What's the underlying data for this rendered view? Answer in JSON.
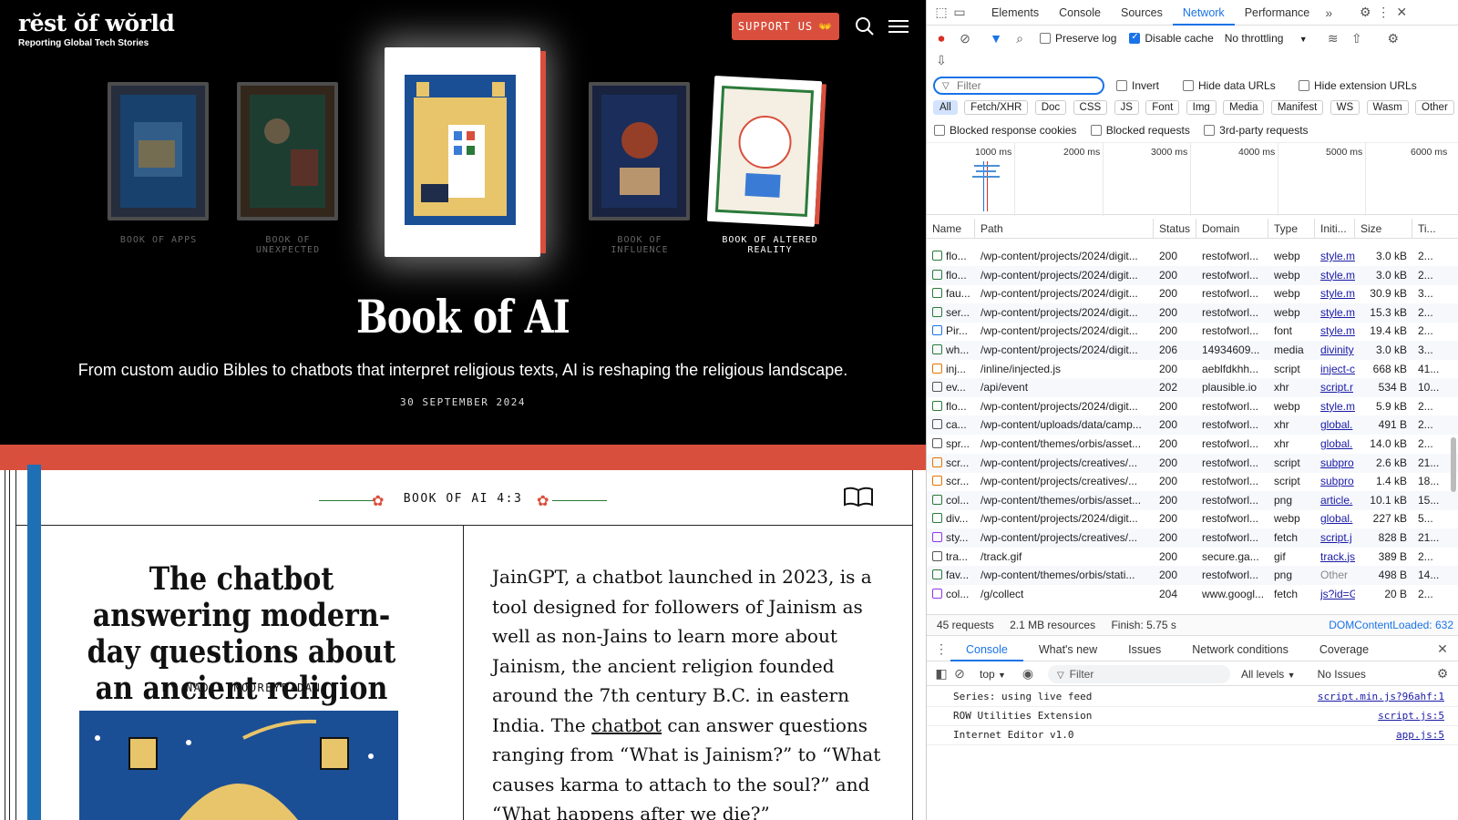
{
  "site": {
    "logo_name": "rĕst ŏf wŏrld",
    "logo_tagline": "Reporting Global Tech Stories",
    "support_label": "SUPPORT US",
    "support_icon": "👐",
    "books": [
      {
        "caption": "BOOK OF APPS"
      },
      {
        "caption": "BOOK OF\nUNEXPECTED"
      },
      {
        "caption": ""
      },
      {
        "caption": "BOOK OF\nINFLUENCE"
      },
      {
        "caption": "BOOK OF ALTERED\nREALITY"
      }
    ],
    "hero_title": "Book of AI",
    "hero_subtitle": "From custom audio Bibles to chatbots that interpret religious texts, AI is reshaping the religious landscape.",
    "hero_date": "30 SEPTEMBER 2024",
    "chapter_label": "BOOK OF AI 4:3",
    "article_title": "The chatbot answering modern-day questions about an ancient religion",
    "byline": "BY NADIA NOOREYEZDAN",
    "body_before_link": "JainGPT, a chatbot launched in 2023, is a tool designed for followers of Jainism as well as non-Jains to learn more about Jainism, the ancient religion founded around the 7th century B.C. in eastern India. The ",
    "body_link": "chatbot",
    "body_after_link": " can answer questions ranging from “What is Jainism?” to “What causes karma to attach to the soul?” and “What happens after we die?”"
  },
  "devtools": {
    "tabs": [
      "Elements",
      "Console",
      "Sources",
      "Network",
      "Performance"
    ],
    "active_tab": "Network",
    "preserve_log": "Preserve log",
    "disable_cache": "Disable cache",
    "throttling": "No throttling",
    "filter_placeholder": "Filter",
    "invert": "Invert",
    "hide_data_urls": "Hide data URLs",
    "hide_ext_urls": "Hide extension URLs",
    "type_chips": [
      "All",
      "Fetch/XHR",
      "Doc",
      "CSS",
      "JS",
      "Font",
      "Img",
      "Media",
      "Manifest",
      "WS",
      "Wasm",
      "Other"
    ],
    "blocked_cookies": "Blocked response cookies",
    "blocked_requests": "Blocked requests",
    "third_party": "3rd-party requests",
    "timeline_labels": [
      "1000 ms",
      "2000 ms",
      "3000 ms",
      "4000 ms",
      "5000 ms",
      "6000 ms"
    ],
    "columns": [
      "Name",
      "Path",
      "Status",
      "Domain",
      "Type",
      "Initi...",
      "Size",
      "Ti..."
    ],
    "rows": [
      {
        "name": "flo...",
        "path": "/wp-content/projects/2024/digit...",
        "status": "200",
        "domain": "restofworl...",
        "type": "webp",
        "init": "style.m",
        "size": "3.0 kB",
        "time": "2..."
      },
      {
        "name": "flo...",
        "path": "/wp-content/projects/2024/digit...",
        "status": "200",
        "domain": "restofworl...",
        "type": "webp",
        "init": "style.m",
        "size": "3.0 kB",
        "time": "2..."
      },
      {
        "name": "fau...",
        "path": "/wp-content/projects/2024/digit...",
        "status": "200",
        "domain": "restofworl...",
        "type": "webp",
        "init": "style.m",
        "size": "30.9 kB",
        "time": "3..."
      },
      {
        "name": "ser...",
        "path": "/wp-content/projects/2024/digit...",
        "status": "200",
        "domain": "restofworl...",
        "type": "webp",
        "init": "style.m",
        "size": "15.3 kB",
        "time": "2..."
      },
      {
        "name": "Pir...",
        "path": "/wp-content/projects/2024/digit...",
        "status": "200",
        "domain": "restofworl...",
        "type": "font",
        "init": "style.m",
        "size": "19.4 kB",
        "time": "2..."
      },
      {
        "name": "wh...",
        "path": "/wp-content/projects/2024/digit...",
        "status": "206",
        "domain": "14934609...",
        "type": "media",
        "init": "divinity",
        "size": "3.0 kB",
        "time": "3..."
      },
      {
        "name": "inj...",
        "path": "/inline/injected.js",
        "status": "200",
        "domain": "aeblfdkhh...",
        "type": "script",
        "init": "inject-c",
        "size": "668 kB",
        "time": "41..."
      },
      {
        "name": "ev...",
        "path": "/api/event",
        "status": "202",
        "domain": "plausible.io",
        "type": "xhr",
        "init": "script.r",
        "size": "534 B",
        "time": "10..."
      },
      {
        "name": "flo...",
        "path": "/wp-content/projects/2024/digit...",
        "status": "200",
        "domain": "restofworl...",
        "type": "webp",
        "init": "style.m",
        "size": "5.9 kB",
        "time": "2..."
      },
      {
        "name": "ca...",
        "path": "/wp-content/uploads/data/camp...",
        "status": "200",
        "domain": "restofworl...",
        "type": "xhr",
        "init": "global.",
        "size": "491 B",
        "time": "2..."
      },
      {
        "name": "spr...",
        "path": "/wp-content/themes/orbis/asset...",
        "status": "200",
        "domain": "restofworl...",
        "type": "xhr",
        "init": "global.",
        "size": "14.0 kB",
        "time": "2..."
      },
      {
        "name": "scr...",
        "path": "/wp-content/projects/creatives/...",
        "status": "200",
        "domain": "restofworl...",
        "type": "script",
        "init": "subpro",
        "size": "2.6 kB",
        "time": "21..."
      },
      {
        "name": "scr...",
        "path": "/wp-content/projects/creatives/...",
        "status": "200",
        "domain": "restofworl...",
        "type": "script",
        "init": "subpro",
        "size": "1.4 kB",
        "time": "18..."
      },
      {
        "name": "col...",
        "path": "/wp-content/themes/orbis/asset...",
        "status": "200",
        "domain": "restofworl...",
        "type": "png",
        "init": "article.",
        "size": "10.1 kB",
        "time": "15..."
      },
      {
        "name": "div...",
        "path": "/wp-content/projects/2024/digit...",
        "status": "200",
        "domain": "restofworl...",
        "type": "webp",
        "init": "global.",
        "size": "227 kB",
        "time": "5..."
      },
      {
        "name": "sty...",
        "path": "/wp-content/projects/creatives/...",
        "status": "200",
        "domain": "restofworl...",
        "type": "fetch",
        "init": "script.j",
        "size": "828 B",
        "time": "21..."
      },
      {
        "name": "tra...",
        "path": "/track.gif",
        "status": "200",
        "domain": "secure.ga...",
        "type": "gif",
        "init": "track.js",
        "size": "389 B",
        "time": "2..."
      },
      {
        "name": "fav...",
        "path": "/wp-content/themes/orbis/stati...",
        "status": "200",
        "domain": "restofworl...",
        "type": "png",
        "init": "Other",
        "size": "498 B",
        "time": "14..."
      },
      {
        "name": "col...",
        "path": "/g/collect",
        "status": "204",
        "domain": "www.googl...",
        "type": "fetch",
        "init": "js?id=G",
        "size": "20 B",
        "time": "2..."
      }
    ],
    "summary_requests": "45 requests",
    "summary_resources": "2.1 MB resources",
    "summary_finish": "Finish: 5.75 s",
    "summary_dcl": "DOMContentLoaded: 632",
    "drawer_tabs": [
      "Console",
      "What's new",
      "Issues",
      "Network conditions",
      "Coverage"
    ],
    "console_context": "top",
    "console_filter": "Filter",
    "console_levels": "All levels",
    "console_issues": "No Issues",
    "console_lines": [
      {
        "msg": "Series: using live feed",
        "src": "script.min.js?96ahf:1"
      },
      {
        "msg": "ROW Utilities Extension",
        "src": "script.js:5"
      },
      {
        "msg": "Internet Editor v1.0",
        "src": "app.js:5"
      }
    ]
  }
}
